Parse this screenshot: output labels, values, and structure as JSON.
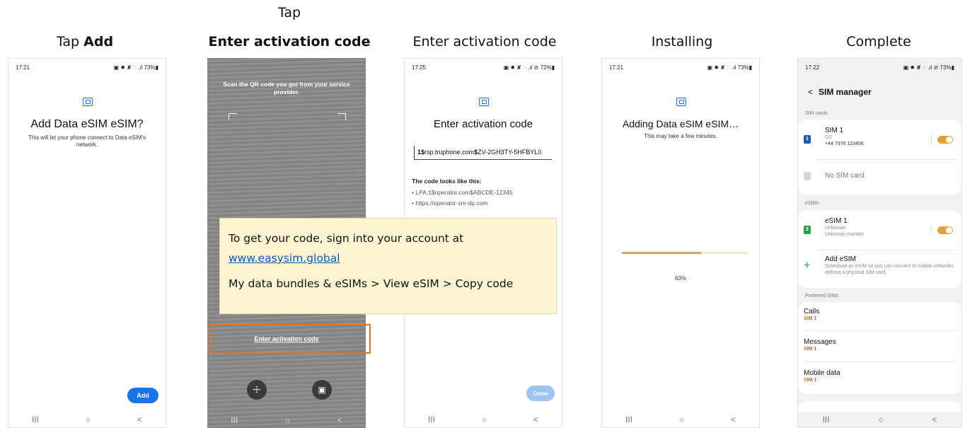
{
  "captions": {
    "step1_prefix": "Tap ",
    "step1_bold": "Add",
    "step2_line1": "Tap",
    "step2_bold": "Enter activation code",
    "step3": "Enter activation code",
    "step4": "Installing",
    "step5": "Complete"
  },
  "phone1": {
    "time": "17:21",
    "status_icons": "▣ ✹ ✘ ◌ .ıl 73%▮",
    "title": "Add Data eSIM eSIM?",
    "description": "This will let your phone connect to Data eSIM's network.",
    "add_button": "Add"
  },
  "phone2": {
    "scan_text": "Scan the QR code you got from your service provider.",
    "enter_code_link": "Enter activation code",
    "flashlight_icon": "☩",
    "gallery_icon": "▣"
  },
  "phone3": {
    "time": "17:25",
    "status_icons": "▣ ✹ ✘ ◌ .ıl ⊘ 72%▮",
    "title": "Enter activation code",
    "code_bold1": "1$",
    "code_part1": "rsp.truphone.com",
    "code_bold2": "$",
    "code_part2": "ZV-2GH3TY-5HFBYL0",
    "hint_title": "The code looks like this:",
    "hint1": "• LPA:1$operator.com$ABCDE-12345",
    "hint2": "• https://operator-sm-dp.com",
    "done_button": "Done"
  },
  "phone4": {
    "time": "17:21",
    "status_icons": "▣ ✹ ✘ ◌ .ıl 73%▮",
    "title": "Adding Data eSIM eSIM…",
    "description": "This may take a few minutes.",
    "progress_label": "63%",
    "progress_fraction": 0.63
  },
  "phone5": {
    "time": "17:22",
    "status_icons": "▣ ✹ ✘ ◌ .ıl ⊘ 73%▮",
    "back": "<",
    "header": "SIM manager",
    "sim_cards_label": "SIM cards",
    "sim1_name": "SIM 1",
    "sim1_carrier": "O2",
    "sim1_number": "+44 7976 123456",
    "sim1_badge": "1",
    "no_sim": "No SIM card",
    "esims_label": "eSIMs",
    "esim1_name": "eSIM 1",
    "esim1_status": "Unknown",
    "esim1_number": "Unknown number",
    "esim1_badge": "2",
    "add_esim_title": "Add eSIM",
    "add_esim_desc": "Download an eSIM so you can connect to mobile networks without a physical SIM card.",
    "add_icon": "+",
    "preferred_label": "Preferred SIMs",
    "calls": "Calls",
    "calls_sim": "SIM 1",
    "messages": "Messages",
    "messages_sim": "SIM 1",
    "mobile_data": "Mobile data",
    "mobile_data_sim": "SIM 1"
  },
  "navbar": {
    "recent": "III",
    "home": "○",
    "back": "<"
  },
  "callout": {
    "line1": "To get your code, sign into your account at",
    "link": "www.easysim.global",
    "line3": "My data bundles & eSIMs > View eSIM > Copy code"
  },
  "colors": {
    "accent_blue": "#1a73e8",
    "toggle_orange": "#e0a33c",
    "highlight_orange": "#e07426",
    "callout_bg": "#fff5d3"
  }
}
